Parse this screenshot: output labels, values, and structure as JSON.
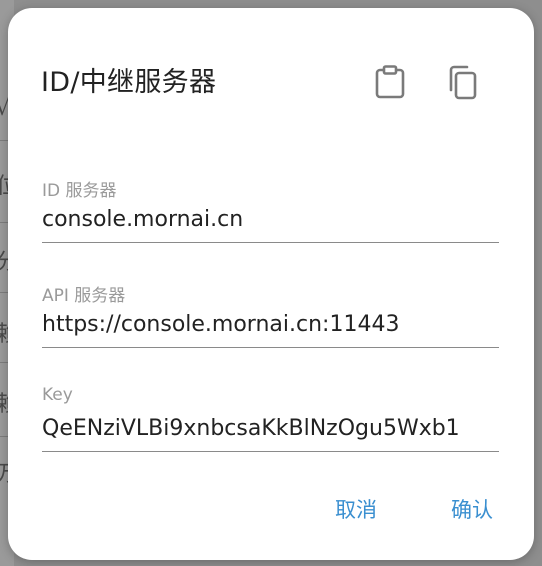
{
  "background": {
    "fragments": [
      "√",
      "位",
      "分",
      "赖",
      "赖",
      "万"
    ]
  },
  "dialog": {
    "title": "ID/中继服务器",
    "icons": {
      "paste": "clipboard-icon",
      "copy": "copy-icon"
    },
    "fields": [
      {
        "label": "ID 服务器",
        "value": "console.mornai.cn"
      },
      {
        "label": "API 服务器",
        "value": "https://console.mornai.cn:11443"
      },
      {
        "label": "Key",
        "value": "QeENziVLBi9xnbcsaKkBlNzOgu5Wxb1"
      }
    ],
    "actions": {
      "cancel": "取消",
      "confirm": "确认"
    },
    "colors": {
      "accent": "#3a8fd0",
      "title": "#222222",
      "label": "#9a9a9a"
    }
  }
}
